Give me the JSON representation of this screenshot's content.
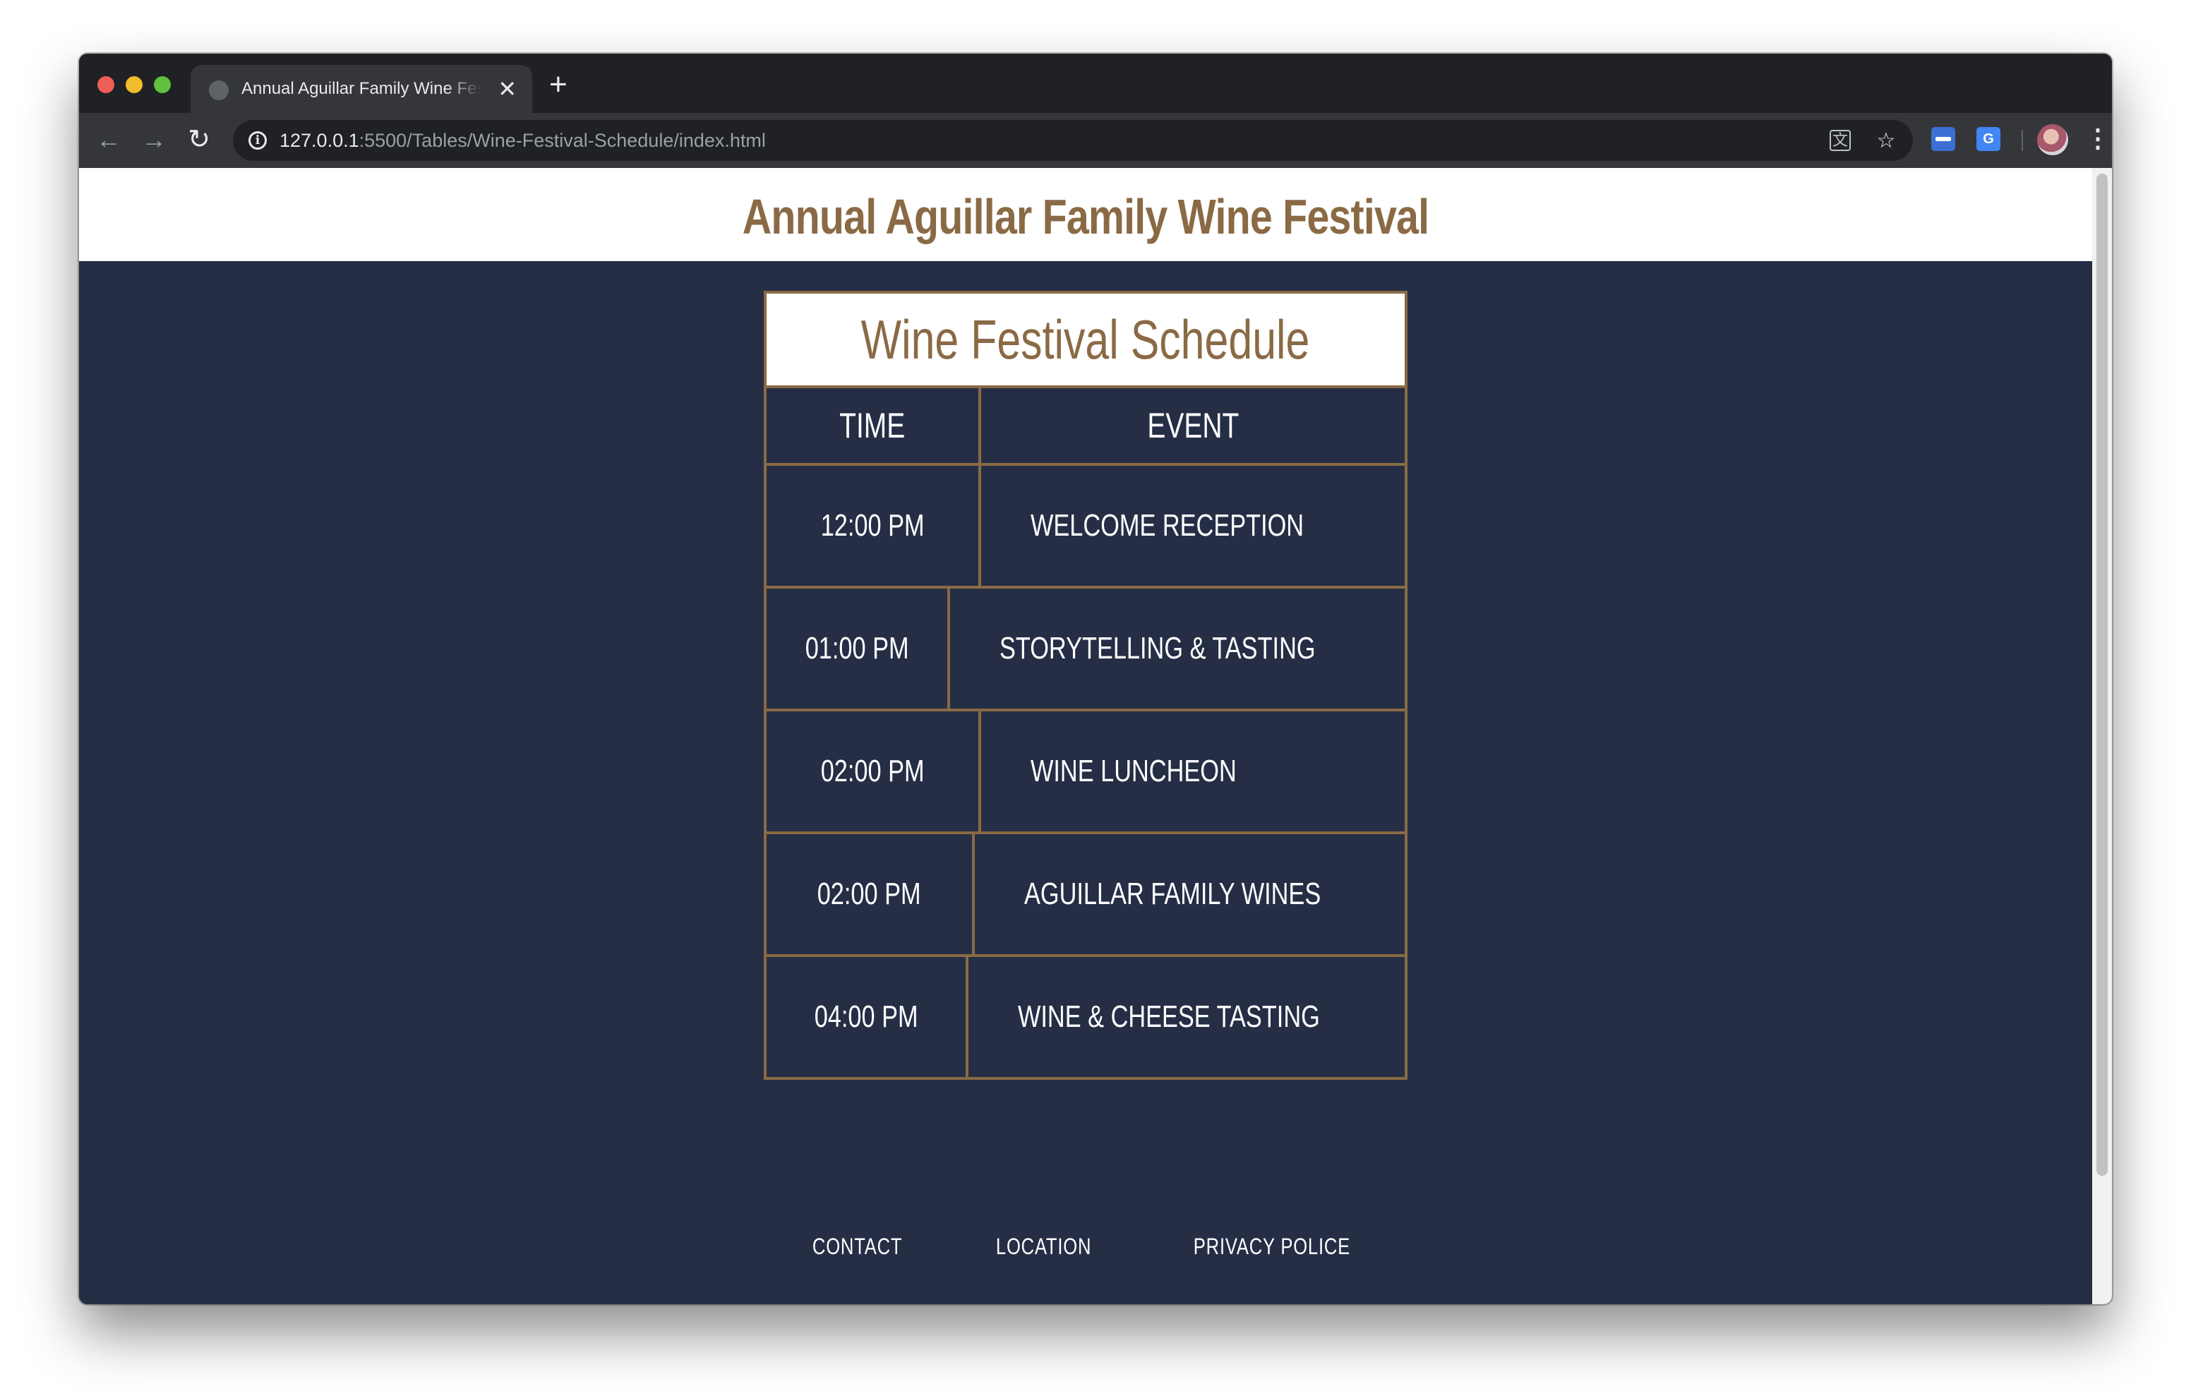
{
  "browser": {
    "tab_title": "Annual Aguillar Family Wine Festival",
    "tab_close": "✕",
    "new_tab": "+",
    "url_host": "127.0.0.1",
    "url_path": ":5500/Tables/Wine-Festival-Schedule/index.html",
    "ext_two_glyph": "G"
  },
  "page": {
    "site_title": "Annual Aguillar Family Wine Festival",
    "schedule": {
      "caption": "Wine Festival Schedule",
      "headers": {
        "time": "TIME",
        "event": "EVENT"
      },
      "rows": [
        {
          "time": "12:00 PM",
          "event": "WELCOME RECEPTION"
        },
        {
          "time": "01:00 PM",
          "event": "STORYTELLING & TASTING"
        },
        {
          "time": "02:00 PM",
          "event": "WINE LUNCHEON"
        },
        {
          "time": "02:00 PM",
          "event": "AGUILLAR FAMILY WINES"
        },
        {
          "time": "04:00 PM",
          "event": "WINE & CHEESE TASTING"
        }
      ]
    },
    "footer": {
      "links": [
        "CONTACT",
        "LOCATION",
        "PRIVACY POLICE"
      ]
    }
  },
  "colors": {
    "accent": "#8a6a45",
    "background": "#252e45",
    "header_bg": "#ffffff",
    "text_light": "#ffffff"
  }
}
